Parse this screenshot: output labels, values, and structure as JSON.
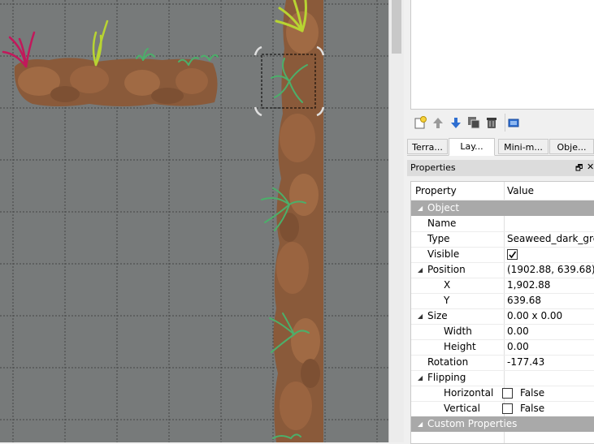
{
  "layer_toolbar": {
    "icons": [
      "new-layer-icon",
      "move-up-icon",
      "move-down-icon",
      "duplicate-icon",
      "delete-icon",
      "show-objects-icon"
    ]
  },
  "tabs": [
    {
      "label": "Terra...",
      "active": false
    },
    {
      "label": "Lay...",
      "active": true
    },
    {
      "label": "Mini-m...",
      "active": false
    },
    {
      "label": "Obje...",
      "active": false
    }
  ],
  "properties_panel": {
    "title": "Properties",
    "float_glyph": "🗗",
    "close_glyph": "✕",
    "col_property": "Property",
    "col_value": "Value",
    "object_group": "Object",
    "name_label": "Name",
    "name_value": "",
    "type_label": "Type",
    "type_value": "Seaweed_dark_green",
    "visible_label": "Visible",
    "visible_checked": true,
    "position_label": "Position",
    "position_value": "(1902.88, 639.68)",
    "x_label": "X",
    "x_value": "1,902.88",
    "y_label": "Y",
    "y_value": "639.68",
    "size_label": "Size",
    "size_value": "0.00 x 0.00",
    "width_label": "Width",
    "width_value": "0.00",
    "height_label": "Height",
    "height_value": "0.00",
    "rotation_label": "Rotation",
    "rotation_value": "-177.43",
    "flipping_label": "Flipping",
    "horizontal_label": "Horizontal",
    "horizontal_value": "False",
    "vertical_label": "Vertical",
    "vertical_value": "False",
    "custom_group": "Custom Properties"
  },
  "colors": {
    "canvas_bg": "#777a7a",
    "rock_main": "#8a5a3a",
    "rock_light": "#a06a44",
    "seaweed_green": "#4caf6a",
    "seaweed_lime": "#b8d432",
    "seaweed_magenta": "#c2185b",
    "group_row": "#a9a9a9"
  }
}
